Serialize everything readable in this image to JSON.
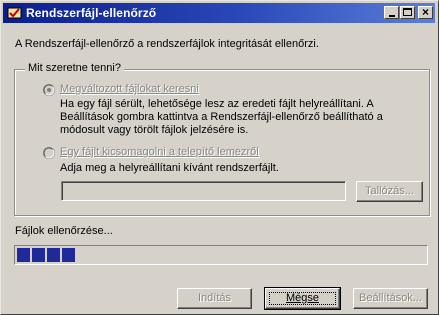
{
  "window": {
    "title": "Rendszerfájl-ellenőrző",
    "controls": {
      "minimize": "_",
      "maximize": "□",
      "close": "×"
    }
  },
  "intro_text": "A Rendszerfájl-ellenőrző a rendszerfájlok integritását ellenőrzi.",
  "group": {
    "legend": "Mit szeretne tenni?",
    "option_scan": {
      "label": "Megváltozott fájlokat keresni",
      "description": [
        "Ha egy fájl sérült, lehetősége lesz az eredeti fájlt helyreállítani. A",
        "Beállítások gombra kattintva a Rendszerfájl-ellenőrző beállítható a",
        "módosult vagy törölt fájlok jelzésére is."
      ],
      "selected": true,
      "enabled": false
    },
    "option_extract": {
      "label": "Egy fájlt kicsomagolni a telepítő lemezről",
      "description": "Adja meg a helyreállítani kívánt rendszerfájlt.",
      "selected": false,
      "enabled": false
    },
    "file_input": {
      "value": "",
      "enabled": false
    },
    "browse_button": {
      "label": "Tallózás...",
      "enabled": false
    }
  },
  "status_text": "Fájlok ellenőrzése...",
  "progress": {
    "filled_chunks": 4,
    "level_fraction": 0.1
  },
  "buttons": {
    "start": {
      "label": "Indítás",
      "enabled": false
    },
    "cancel": {
      "label": "Mégse",
      "enabled": true,
      "default": true
    },
    "settings": {
      "label": "Beállítások...",
      "enabled": false
    }
  },
  "colors": {
    "title_gradient_start": "#0a1f8c",
    "title_gradient_end": "#5a7fd8",
    "face": "#d4d0c8",
    "progress_fill": "#1e2a9a",
    "disabled_text": "#888888"
  },
  "icons": {
    "app": "checkbook-icon"
  }
}
